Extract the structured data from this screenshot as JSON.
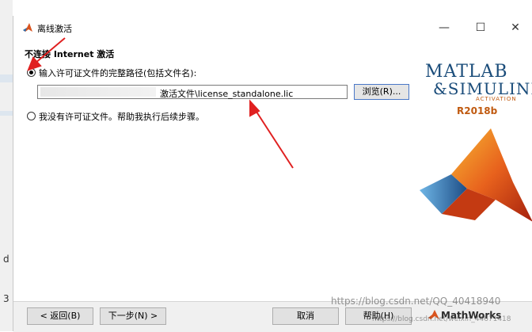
{
  "window": {
    "title": "离线激活",
    "minimize_glyph": "—",
    "maximize_glyph": "☐",
    "close_glyph": "✕",
    "app_icon": "matlab-membrane-icon"
  },
  "section_heading": "不连接 Internet 激活",
  "options": [
    {
      "label": "输入许可证文件的完整路径(包括文件名):",
      "selected": true
    },
    {
      "label": "我没有许可证文件。帮助我执行后续步骤。",
      "selected": false
    }
  ],
  "license_path": {
    "visible_value": "激活文件\\license_standalone.lic"
  },
  "browse_button": "浏览(R)...",
  "logo": {
    "line1": "MATLAB",
    "line2": "&SIMULINK",
    "activation": "ACTIVATION",
    "release": "R2018b"
  },
  "footer": {
    "back": "< 返回(B)",
    "next": "下一步(N) >",
    "cancel": "取消",
    "help": "帮助(H)",
    "brand": "MathWorks"
  },
  "watermarks": [
    "https://blog.csdn.net/QQ_40418940",
    "https://blog.csdn.net/weixin_44671418"
  ],
  "colors": {
    "arrow": "#e02020",
    "logo_blue": "#1a4c7a",
    "logo_orange": "#c05a10"
  }
}
